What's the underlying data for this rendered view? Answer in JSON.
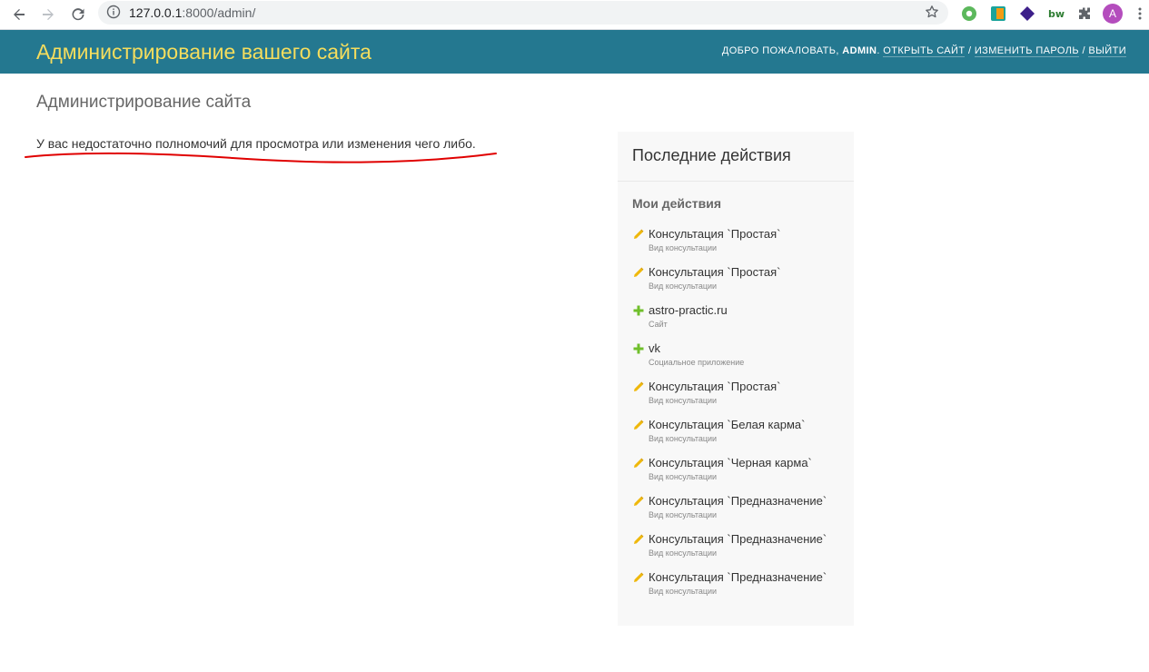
{
  "browser": {
    "url_host": "127.0.0.1",
    "url_rest": ":8000/admin/",
    "profile_initial": "A"
  },
  "header": {
    "branding": "Администрирование вашего сайта",
    "welcome": "ДОБРО ПОЖАЛОВАТЬ,",
    "username": "ADMIN",
    "links": {
      "view_site": "ОТКРЫТЬ САЙТ",
      "change_password": "ИЗМЕНИТЬ ПАРОЛЬ",
      "logout": "ВЫЙТИ"
    },
    "separator": "/"
  },
  "main": {
    "title": "Администрирование сайта",
    "message": "У вас недостаточно полномочий для просмотра или изменения чего либо."
  },
  "recent_actions": {
    "title": "Последние действия",
    "subtitle": "Мои действия",
    "items": [
      {
        "icon": "pencil-icon",
        "title": "Консультация `Простая`",
        "type": "Вид консультации"
      },
      {
        "icon": "pencil-icon",
        "title": "Консультация `Простая`",
        "type": "Вид консультации"
      },
      {
        "icon": "plus-icon",
        "title": "astro-practic.ru",
        "type": "Сайт"
      },
      {
        "icon": "plus-icon",
        "title": "vk",
        "type": "Социальное приложение"
      },
      {
        "icon": "pencil-icon",
        "title": "Консультация `Простая`",
        "type": "Вид консультации"
      },
      {
        "icon": "pencil-icon",
        "title": "Консультация `Белая карма`",
        "type": "Вид консультации"
      },
      {
        "icon": "pencil-icon",
        "title": "Консультация `Черная карма`",
        "type": "Вид консультации"
      },
      {
        "icon": "pencil-icon",
        "title": "Консультация `Предназначение`",
        "type": "Вид консультации"
      },
      {
        "icon": "pencil-icon",
        "title": "Консультация `Предназначение`",
        "type": "Вид консультации"
      },
      {
        "icon": "pencil-icon",
        "title": "Консультация `Предназначение`",
        "type": "Вид консультации"
      }
    ]
  },
  "colors": {
    "header_bg": "#247890",
    "branding": "#f5dd5d",
    "pencil": "#efb80b",
    "plus": "#70bf2b",
    "annotation": "#e00000"
  }
}
